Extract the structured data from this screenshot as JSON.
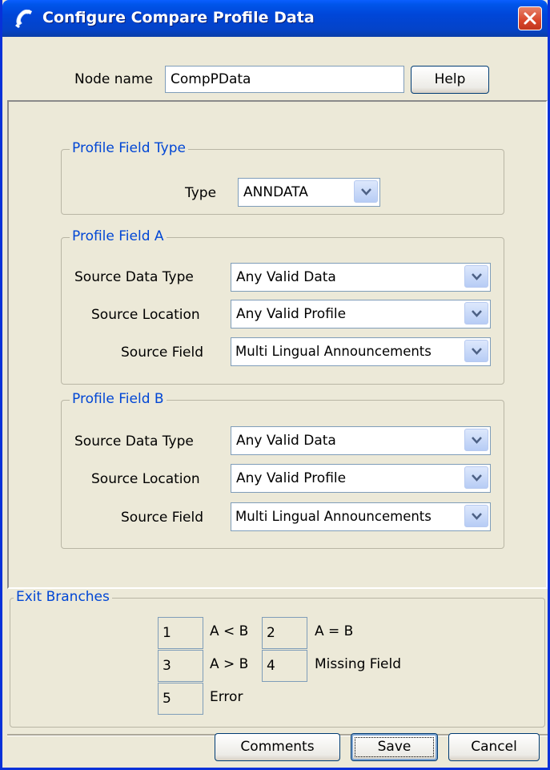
{
  "window": {
    "title": "Configure Compare Profile Data",
    "icon": "phone-handset-icon",
    "close_icon": "close-icon"
  },
  "node": {
    "label": "Node name",
    "value": "CompPData",
    "help_label": "Help"
  },
  "field_type": {
    "title": "Profile Field Type",
    "type_label": "Type",
    "type_value": "ANNDATA"
  },
  "field_a": {
    "title": "Profile Field A",
    "source_data_type_label": "Source Data Type",
    "source_data_type_value": "Any Valid Data",
    "source_location_label": "Source Location",
    "source_location_value": "Any Valid Profile",
    "source_field_label": "Source Field",
    "source_field_value": "Multi Lingual Announcements"
  },
  "field_b": {
    "title": "Profile Field B",
    "source_data_type_label": "Source Data Type",
    "source_data_type_value": "Any Valid Data",
    "source_location_label": "Source Location",
    "source_location_value": "Any Valid Profile",
    "source_field_label": "Source Field",
    "source_field_value": "Multi Lingual Announcements"
  },
  "exit_branches": {
    "title": "Exit Branches",
    "branches": [
      {
        "num": "1",
        "label": "A < B"
      },
      {
        "num": "2",
        "label": "A = B"
      },
      {
        "num": "3",
        "label": "A > B"
      },
      {
        "num": "4",
        "label": "Missing Field"
      },
      {
        "num": "5",
        "label": "Error"
      }
    ]
  },
  "footer": {
    "comments_label": "Comments",
    "save_label": "Save",
    "cancel_label": "Cancel"
  },
  "colors": {
    "titlebar": "#0046d8",
    "group_title": "#0046d5",
    "background": "#ece9d8",
    "close": "#d9462a"
  }
}
